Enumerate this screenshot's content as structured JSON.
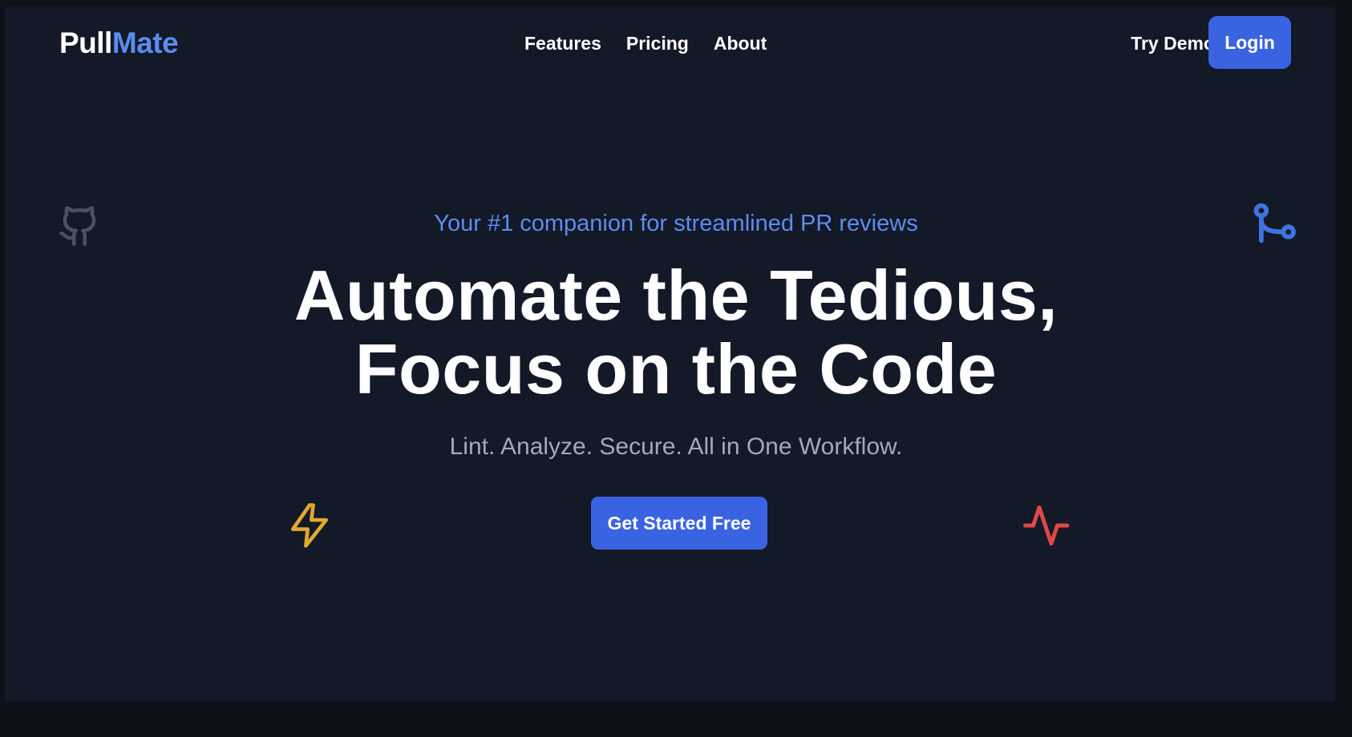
{
  "header": {
    "logo_part1": "Pull",
    "logo_part2": "Mate",
    "nav": [
      {
        "label": "Features"
      },
      {
        "label": "Pricing"
      },
      {
        "label": "About"
      }
    ],
    "try_demo_label": "Try Demo",
    "login_label": "Login"
  },
  "hero": {
    "tagline": "Your #1 companion for streamlined PR reviews",
    "headline_line1": "Automate the Tedious,",
    "headline_line2": "Focus on the Code",
    "subline": "Lint. Analyze. Secure. All in One Workflow.",
    "cta_label": "Get Started Free"
  },
  "icons": {
    "github": "github-icon",
    "git_merge": "git-merge-icon",
    "lightning": "lightning-icon",
    "activity": "activity-pulse-icon"
  },
  "colors": {
    "background": "#141928",
    "outer_background": "#0e1117",
    "accent": "#3a63e2",
    "accent_text": "#5b8def",
    "text": "#ffffff",
    "muted_text": "#a5a9b3",
    "github_icon": "#4b5161",
    "lightning_icon": "#e0a92e",
    "activity_icon": "#e04848"
  }
}
